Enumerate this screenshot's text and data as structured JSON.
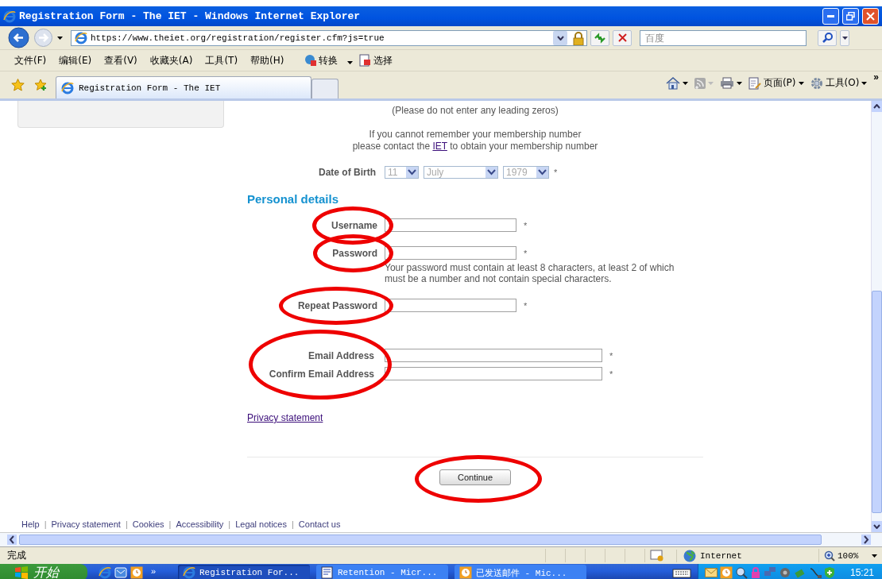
{
  "window": {
    "title": "Registration Form - The IET - Windows Internet Explorer"
  },
  "address_bar": {
    "url": "https://www.theiet.org/registration/register.cfm?js=true"
  },
  "search_box": {
    "placeholder": "百度"
  },
  "menu_bar": [
    {
      "label": "文件(F)"
    },
    {
      "label": "编辑(E)"
    },
    {
      "label": "查看(V)"
    },
    {
      "label": "收藏夹(A)"
    },
    {
      "label": "工具(T)"
    },
    {
      "label": "帮助(H)"
    }
  ],
  "menu_tools": [
    {
      "label": "转换"
    },
    {
      "label": "选择"
    }
  ],
  "tabs": [
    {
      "label": "Registration Form - The IET",
      "selected": true
    }
  ],
  "command_bar": [
    {
      "label": "页面(P)"
    },
    {
      "label": "工具(O)"
    }
  ],
  "command_overflow": "»",
  "page": {
    "membership_note": "(Please do not enter any leading zeros)",
    "contact_line": "If you cannot remember your membership number",
    "contact_prefix": "please contact the ",
    "contact_link": "IET",
    "contact_suffix": " to obtain your membership number",
    "date_of_birth": {
      "label": "Date of Birth",
      "day": "11",
      "month": "July",
      "year": "1979",
      "required": "*"
    },
    "section_title": "Personal details",
    "rows": [
      {
        "kind": "field",
        "circled": true,
        "fields": [
          {
            "label": "Username",
            "required": "*"
          }
        ]
      },
      {
        "kind": "field",
        "circled": true,
        "fields": [
          {
            "label": "Password",
            "required": "*",
            "hint": "Your password must contain at least 8 characters, at least 2 of which must be a number and not contain special characters."
          }
        ]
      },
      {
        "kind": "field",
        "circled": true,
        "fields": [
          {
            "label": "Repeat Password",
            "required": "*"
          }
        ]
      },
      {
        "kind": "pair",
        "circled": true,
        "fields": [
          {
            "label": "Email Address",
            "required": "*"
          },
          {
            "label": "Confirm Email Address",
            "required": "*"
          }
        ]
      }
    ],
    "privacy_link": "Privacy statement",
    "continue_button": {
      "label": "Continue",
      "circled": true
    },
    "footer_links": [
      {
        "label": "Help"
      },
      {
        "separator": "|",
        "label": "Privacy statement"
      },
      {
        "separator": "|",
        "label": "Cookies"
      },
      {
        "separator": "|",
        "label": "Accessibility"
      },
      {
        "separator": "|",
        "label": "Legal notices"
      },
      {
        "separator": "|",
        "label": "Contact us"
      }
    ]
  },
  "status_bar": {
    "text": "完成",
    "zone": "Internet",
    "zoom": "100%"
  },
  "taskbar": {
    "start": "开始",
    "quick_launch_overflow": "»",
    "tasks": [
      {
        "label": "Registration For...",
        "kind": "browser",
        "selected": true
      },
      {
        "label": "Retention - Micr...",
        "kind": "document",
        "selected": false
      },
      {
        "label": "已发送邮件 - Mic...",
        "kind": "mail",
        "selected": false
      }
    ],
    "clock": "15:21"
  }
}
